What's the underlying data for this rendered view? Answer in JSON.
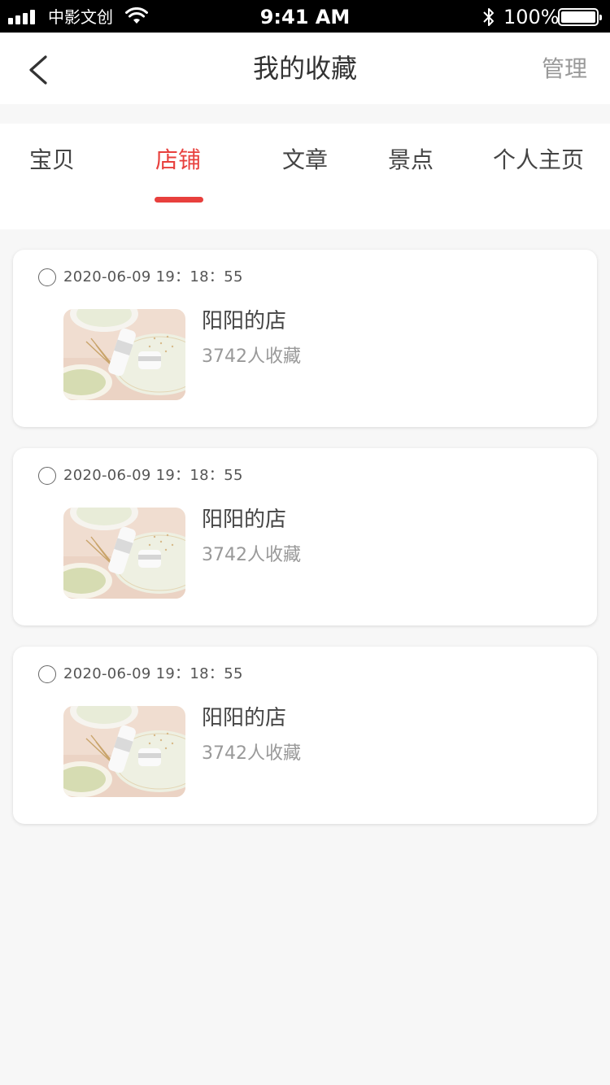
{
  "status_bar": {
    "carrier": "中影文创",
    "time": "9:41 AM",
    "battery": "100%"
  },
  "nav": {
    "title": "我的收藏",
    "manage_label": "管理",
    "back_icon": "chevron-left-icon"
  },
  "tabs": [
    {
      "label": "宝贝",
      "active": false
    },
    {
      "label": "店铺",
      "active": true
    },
    {
      "label": "文章",
      "active": false
    },
    {
      "label": "景点",
      "active": false
    },
    {
      "label": "个人主页",
      "active": false
    }
  ],
  "accent_color": "#e8403d",
  "items": [
    {
      "date": "2020-06-09 19：18：55",
      "shop_name": "阳阳的店",
      "fav_count": "3742人收藏"
    },
    {
      "date": "2020-06-09 19：18：55",
      "shop_name": "阳阳的店",
      "fav_count": "3742人收藏"
    },
    {
      "date": "2020-06-09 19：18：55",
      "shop_name": "阳阳的店",
      "fav_count": "3742人收藏"
    }
  ]
}
